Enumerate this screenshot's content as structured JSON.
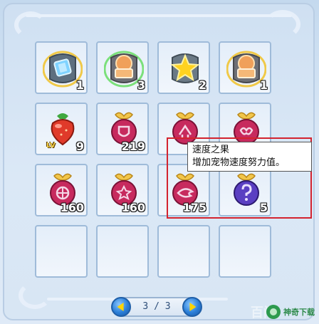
{
  "inventory": {
    "slots": [
      {
        "icon": "blue-card-stone-icon",
        "count": "1"
      },
      {
        "icon": "orange-book-stone-icon",
        "count": "3"
      },
      {
        "icon": "gold-star-stone-icon",
        "count": "2"
      },
      {
        "icon": "orange-book-stone-icon",
        "count": "1"
      },
      {
        "icon": "level-strawberry-fruit-icon",
        "count": "9",
        "badge": "LV"
      },
      {
        "icon": "shield-fruit-icon",
        "count": "219"
      },
      {
        "icon": "speed-arrow-fruit-icon",
        "count": ""
      },
      {
        "icon": "heart-knot-fruit-icon",
        "count": ""
      },
      {
        "icon": "lattice-fruit-icon",
        "count": "160"
      },
      {
        "icon": "star-fruit-icon",
        "count": "160"
      },
      {
        "icon": "wing-fruit-icon",
        "count": "175"
      },
      {
        "icon": "question-mark-fruit-icon",
        "count": "5"
      },
      {
        "icon": "",
        "count": ""
      },
      {
        "icon": "",
        "count": ""
      },
      {
        "icon": "",
        "count": ""
      },
      {
        "icon": "",
        "count": ""
      }
    ]
  },
  "tooltip": {
    "title": "速度之果",
    "description": "增加宠物速度努力值。"
  },
  "pager": {
    "text": "3 / 3"
  },
  "watermark": {
    "text": "神奇下载",
    "ghost_text": "百门"
  },
  "colors": {
    "highlight_border": "#d3232f",
    "panel_bg": "#cfe0f2",
    "slot_border": "#9fbbd9",
    "pager_button": "#2b7fd8"
  }
}
